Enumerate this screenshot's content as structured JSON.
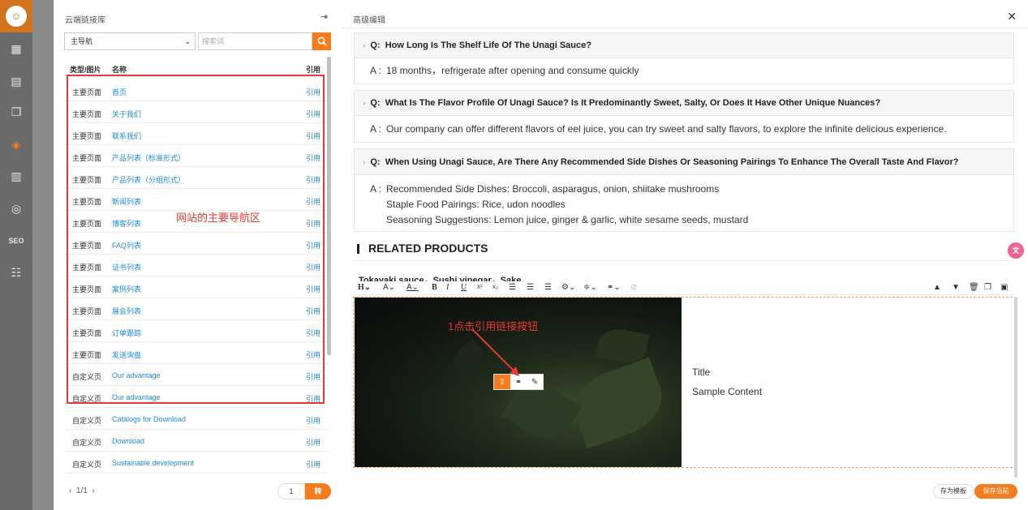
{
  "left_panel": {
    "title": "云端链接库",
    "select_value": "主导航",
    "search_placeholder": "搜索词",
    "columns": {
      "type": "类型/图片",
      "name": "名称",
      "ref": "引用"
    },
    "rows": [
      {
        "type": "主要页面",
        "name": "首页",
        "ref": "引用"
      },
      {
        "type": "主要页面",
        "name": "关于我们",
        "ref": "引用"
      },
      {
        "type": "主要页面",
        "name": "联系我们",
        "ref": "引用"
      },
      {
        "type": "主要页面",
        "name": "产品列表（标准形式）",
        "ref": "引用"
      },
      {
        "type": "主要页面",
        "name": "产品列表（分组形式）",
        "ref": "引用"
      },
      {
        "type": "主要页面",
        "name": "新闻列表",
        "ref": "引用"
      },
      {
        "type": "主要页面",
        "name": "博客列表",
        "ref": "引用"
      },
      {
        "type": "主要页面",
        "name": "FAQ列表",
        "ref": "引用"
      },
      {
        "type": "主要页面",
        "name": "证书列表",
        "ref": "引用"
      },
      {
        "type": "主要页面",
        "name": "案例列表",
        "ref": "引用"
      },
      {
        "type": "主要页面",
        "name": "展会列表",
        "ref": "引用"
      },
      {
        "type": "主要页面",
        "name": "订单跟踪",
        "ref": "引用"
      },
      {
        "type": "主要页面",
        "name": "发送询盘",
        "ref": "引用"
      },
      {
        "type": "自定义页",
        "name": "Our advantage",
        "ref": "引用"
      },
      {
        "type": "自定义页",
        "name": "Our advantage",
        "ref": "引用"
      },
      {
        "type": "自定义页",
        "name": "Catalogs for Download",
        "ref": "引用"
      },
      {
        "type": "自定义页",
        "name": "Download",
        "ref": "引用"
      },
      {
        "type": "自定义页",
        "name": "Sustainable development",
        "ref": "引用"
      }
    ],
    "annotation": "网站的主要导航区",
    "pager_text": "1/1",
    "page_input": "1",
    "go_label": "转"
  },
  "right_panel": {
    "title": "高级编辑",
    "faqs": [
      {
        "q": "How Long Is The Shelf Life Of The Unagi Sauce?",
        "a": [
          "18 months，refrigerate after opening and consume quickly"
        ]
      },
      {
        "q": "What Is The Flavor Profile Of Unagi Sauce? Is It Predominantly Sweet, Salty, Or Does It Have Other Unique Nuances?",
        "a": [
          "Our company can offer different flavors of eel juice, you can try sweet and salty flavors, to explore the infinite delicious experience."
        ]
      },
      {
        "q": "When Using Unagi Sauce, Are There Any Recommended Side Dishes Or Seasoning Pairings To Enhance The Overall Taste And Flavor?",
        "a": [
          "Recommended Side Dishes: Broccoli, asparagus, onion, shiitake mushrooms",
          "Staple Food Pairings: Rice, udon noodles",
          "Seasoning Suggestions: Lemon juice, ginger & garlic, white sesame seeds, mustard"
        ]
      }
    ],
    "q_prefix": "Q:",
    "a_prefix": "A :",
    "related_heading": "RELATED PRODUCTS",
    "products_text": "Tokayaki sauce，Sushi vinegar，Sake",
    "card_title": "Title",
    "card_content": "Sample Content",
    "annotation": "1点击引用链接按钮",
    "save_template_label": "存为模板",
    "save_current_label": "保存当前"
  }
}
